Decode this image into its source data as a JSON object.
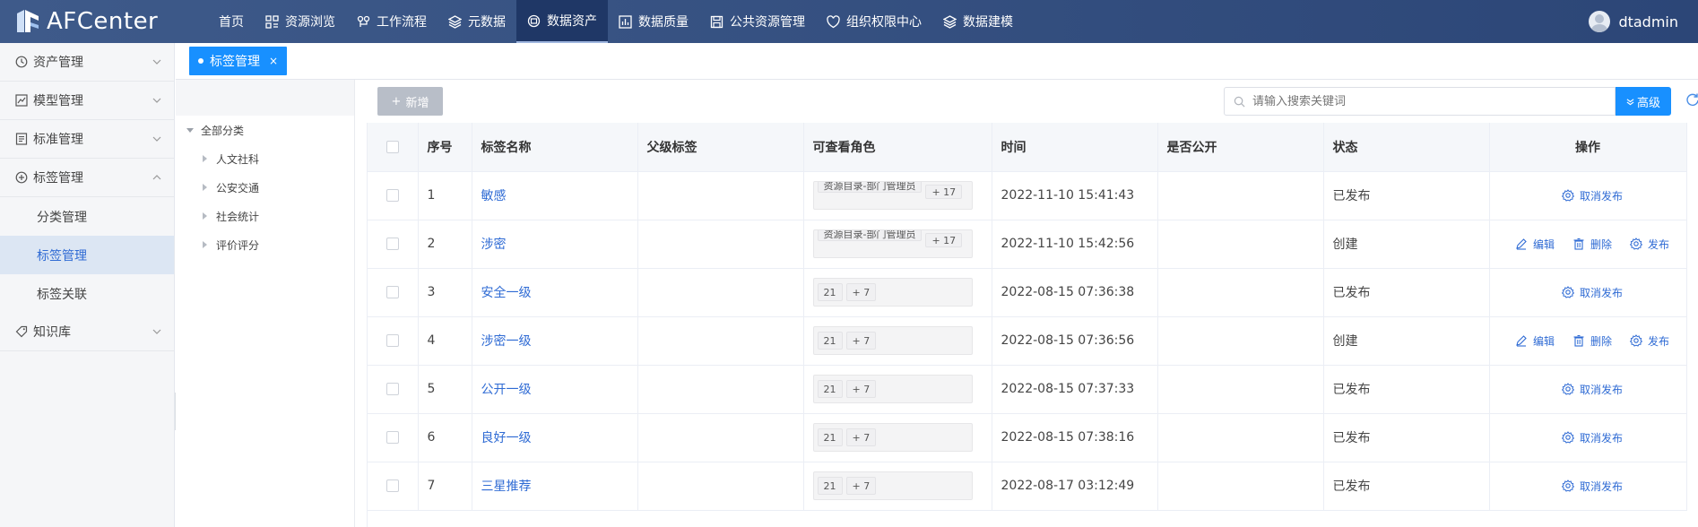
{
  "app": {
    "name": "AFCenter"
  },
  "nav": [
    {
      "label": "首页",
      "icon": "none"
    },
    {
      "label": "资源浏览",
      "icon": "grid-icon"
    },
    {
      "label": "工作流程",
      "icon": "workflow-icon"
    },
    {
      "label": "元数据",
      "icon": "layers-icon"
    },
    {
      "label": "数据资产",
      "icon": "asset-icon",
      "active": true
    },
    {
      "label": "数据质量",
      "icon": "chart-icon"
    },
    {
      "label": "公共资源管理",
      "icon": "save-icon"
    },
    {
      "label": "组织权限中心",
      "icon": "shield-heart-icon"
    },
    {
      "label": "数据建模",
      "icon": "layers-icon"
    }
  ],
  "user": {
    "name": "dtadmin"
  },
  "sidebar": {
    "items": [
      {
        "label": "资产管理",
        "icon": "clock-icon"
      },
      {
        "label": "模型管理",
        "icon": "chart-icon"
      },
      {
        "label": "标准管理",
        "icon": "document-icon"
      },
      {
        "label": "标签管理",
        "icon": "plus-circle-icon",
        "expanded": true
      },
      {
        "label": "知识库",
        "icon": "tag-icon"
      }
    ],
    "sub_items": [
      {
        "label": "分类管理"
      },
      {
        "label": "标签管理",
        "active": true
      },
      {
        "label": "标签关联"
      }
    ]
  },
  "tabs": [
    {
      "label": "标签管理",
      "close": "×"
    }
  ],
  "tree": {
    "root": "全部分类",
    "children": [
      "人文社科",
      "公安交通",
      "社会统计",
      "评价评分"
    ]
  },
  "toolbar": {
    "new_label": "新增",
    "new_prefix": "+",
    "search_placeholder": "请输入搜索关键词",
    "advanced_label": "高级"
  },
  "table": {
    "headers": [
      "序号",
      "标签名称",
      "父级标签",
      "可查看角色",
      "时间",
      "是否公开",
      "状态",
      "操作"
    ],
    "op_labels": {
      "edit": "编辑",
      "delete": "删除",
      "publish": "发布",
      "unpublish": "取消发布"
    },
    "rows": [
      {
        "index": "1",
        "name": "敏感",
        "parent": "",
        "roles": [
          "资源目录-部门管理员",
          "+ 17"
        ],
        "roles_style": "double",
        "time": "2022-11-10 15:41:43",
        "public": "",
        "status": "已发布",
        "ops": "published"
      },
      {
        "index": "2",
        "name": "涉密",
        "parent": "",
        "roles": [
          "资源目录-部门管理员",
          "+ 17"
        ],
        "roles_style": "double",
        "time": "2022-11-10 15:42:56",
        "public": "",
        "status": "创建",
        "ops": "created"
      },
      {
        "index": "3",
        "name": "安全一级",
        "parent": "",
        "roles": [
          "21",
          "+ 7"
        ],
        "roles_style": "single",
        "time": "2022-08-15 07:36:38",
        "public": "",
        "status": "已发布",
        "ops": "published"
      },
      {
        "index": "4",
        "name": "涉密一级",
        "parent": "",
        "roles": [
          "21",
          "+ 7"
        ],
        "roles_style": "single",
        "time": "2022-08-15 07:36:56",
        "public": "",
        "status": "创建",
        "ops": "created"
      },
      {
        "index": "5",
        "name": "公开一级",
        "parent": "",
        "roles": [
          "21",
          "+ 7"
        ],
        "roles_style": "single",
        "time": "2022-08-15 07:37:33",
        "public": "",
        "status": "已发布",
        "ops": "published"
      },
      {
        "index": "6",
        "name": "良好一级",
        "parent": "",
        "roles": [
          "21",
          "+ 7"
        ],
        "roles_style": "single",
        "time": "2022-08-15 07:38:16",
        "public": "",
        "status": "已发布",
        "ops": "published"
      },
      {
        "index": "7",
        "name": "三星推荐",
        "parent": "",
        "roles": [
          "21",
          "+ 7"
        ],
        "roles_style": "single",
        "time": "2022-08-17 03:12:49",
        "public": "",
        "status": "已发布",
        "ops": "published"
      }
    ]
  },
  "colors": {
    "topbar": "#2c4677",
    "accent": "#1890ff",
    "link": "#2f6bd4",
    "sidebar_active": "#dce6f3"
  }
}
